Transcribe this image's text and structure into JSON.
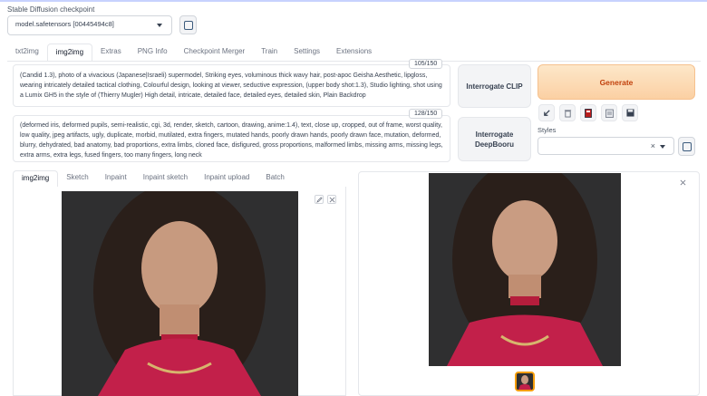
{
  "checkpoint": {
    "label": "Stable Diffusion checkpoint",
    "value": "model.safetensors [00445494c8]"
  },
  "tabs": [
    "txt2img",
    "img2img",
    "Extras",
    "PNG Info",
    "Checkpoint Merger",
    "Train",
    "Settings",
    "Extensions"
  ],
  "active_tab": "img2img",
  "prompt": {
    "counter": "105/150",
    "text": "(Candid 1.3), photo of a vivacious (Japanese|Israeli) supermodel, Striking eyes, voluminous thick wavy hair, post-apoc Geisha Aesthetic, lipgloss, wearing intricately detailed tactical clothing, Colourful design, looking at viewer, seductive expression, (upper body shot:1.3), Studio lighting, shot using a Lumix GH5 in the style of (Thierry Mugler) High detail, intricate, detailed face, detailed eyes, detailed skin, Plain Backdrop"
  },
  "negative_prompt": {
    "counter": "128/150",
    "text": "(deformed iris, deformed pupils, semi-realistic, cgi, 3d, render, sketch, cartoon, drawing, anime:1.4), text, close up, cropped, out of frame, worst quality, low quality, jpeg artifacts, ugly, duplicate, morbid, mutilated, extra fingers, mutated hands, poorly drawn hands, poorly drawn face, mutation, deformed, blurry, dehydrated, bad anatomy, bad proportions, extra limbs, cloned face, disfigured, gross proportions, malformed limbs, missing arms, missing legs, extra arms, extra legs, fused fingers, too many fingers, long neck"
  },
  "buttons": {
    "interrogate_clip": "Interrogate CLIP",
    "interrogate_deepbooru": "Interrogate DeepBooru",
    "generate": "Generate"
  },
  "tool_icons": [
    "arrow-icon",
    "trash-icon",
    "red-book-icon",
    "clipboard-icon",
    "save-icon"
  ],
  "styles": {
    "label": "Styles",
    "value": "",
    "clear_glyph": "×"
  },
  "subtabs": [
    "img2img",
    "Sketch",
    "Inpaint",
    "Inpaint sketch",
    "Inpaint upload",
    "Batch"
  ],
  "active_subtab": "img2img",
  "colors": {
    "generate_bg": "#fbd0a3",
    "generate_text": "#c2410c",
    "thumb_border": "#f59e0b"
  }
}
